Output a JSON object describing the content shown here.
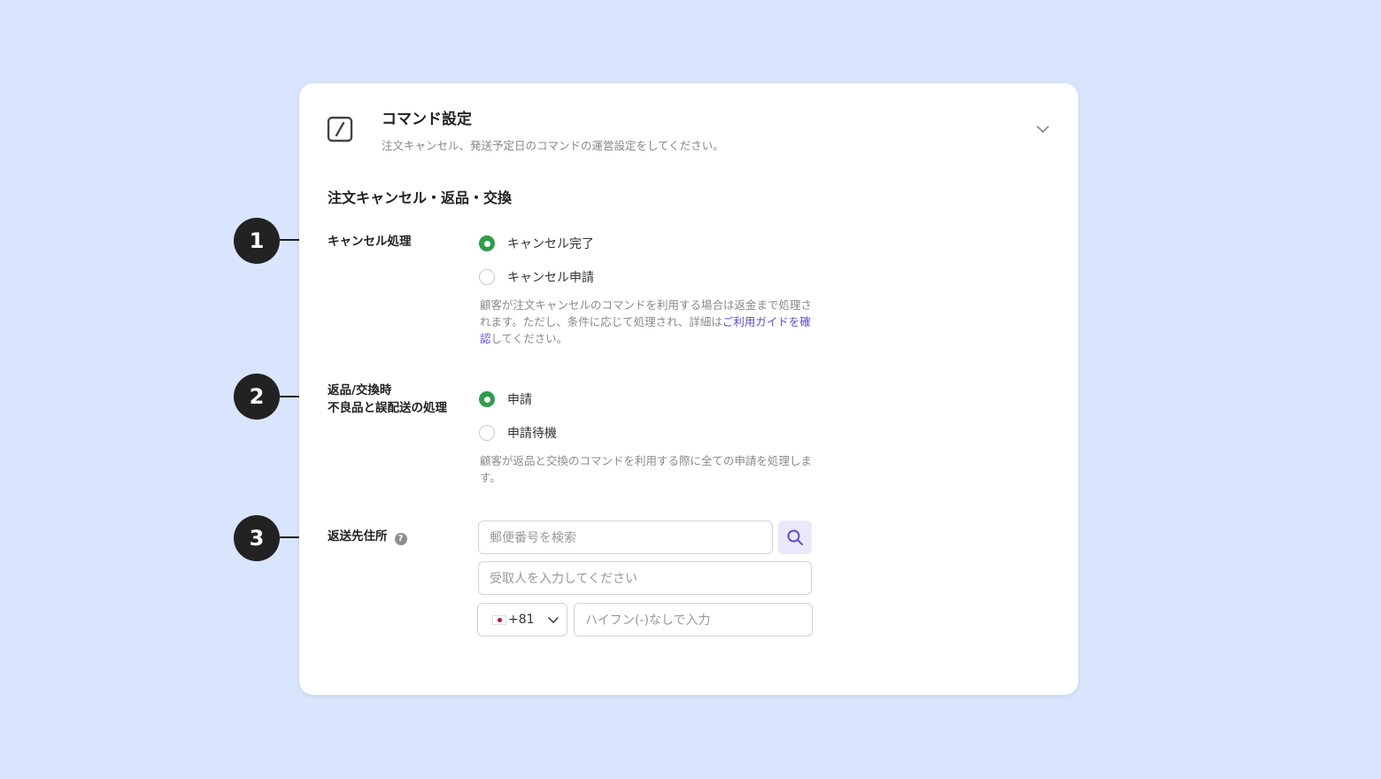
{
  "card": {
    "title": "コマンド設定",
    "subtitle": "注文キャンセル、発送予定日のコマンドの運営設定をしてください。",
    "icon": "slash-command-icon",
    "collapse_icon": "chevron-down-icon"
  },
  "section": {
    "title": "注文キャンセル・返品・交換"
  },
  "cancel": {
    "label": "キャンセル処理",
    "options": [
      {
        "label": "キャンセル完了",
        "selected": true
      },
      {
        "label": "キャンセル申請",
        "selected": false
      }
    ],
    "help_prefix": "顧客が注文キャンセルのコマンドを利用する場合は返金まで処理されます。ただし、条件に応じて処理され、詳細は",
    "help_link": "ご利用ガイドを確認",
    "help_suffix": "してください。"
  },
  "return_exchange": {
    "label_line1": "返品/交換時",
    "label_line2": "不良品と誤配送の処理",
    "options": [
      {
        "label": "申請",
        "selected": true
      },
      {
        "label": "申請待機",
        "selected": false
      }
    ],
    "help": "顧客が返品と交換のコマンドを利用する際に全ての申請を処理します。"
  },
  "return_address": {
    "label": "返送先住所",
    "help_icon": "question-icon",
    "postal_placeholder": "郵便番号を検索",
    "search_icon": "search-icon",
    "recipient_placeholder": "受取人を入力してください",
    "country_code": "+81",
    "country_flag": "japan-flag-icon",
    "phone_placeholder": "ハイフン(-)なしで入力"
  },
  "callouts": [
    "1",
    "2",
    "3"
  ],
  "colors": {
    "background": "#d8e5fd",
    "accent_green": "#2e9d4c",
    "link": "#5b4fd6",
    "badge": "#222222"
  }
}
